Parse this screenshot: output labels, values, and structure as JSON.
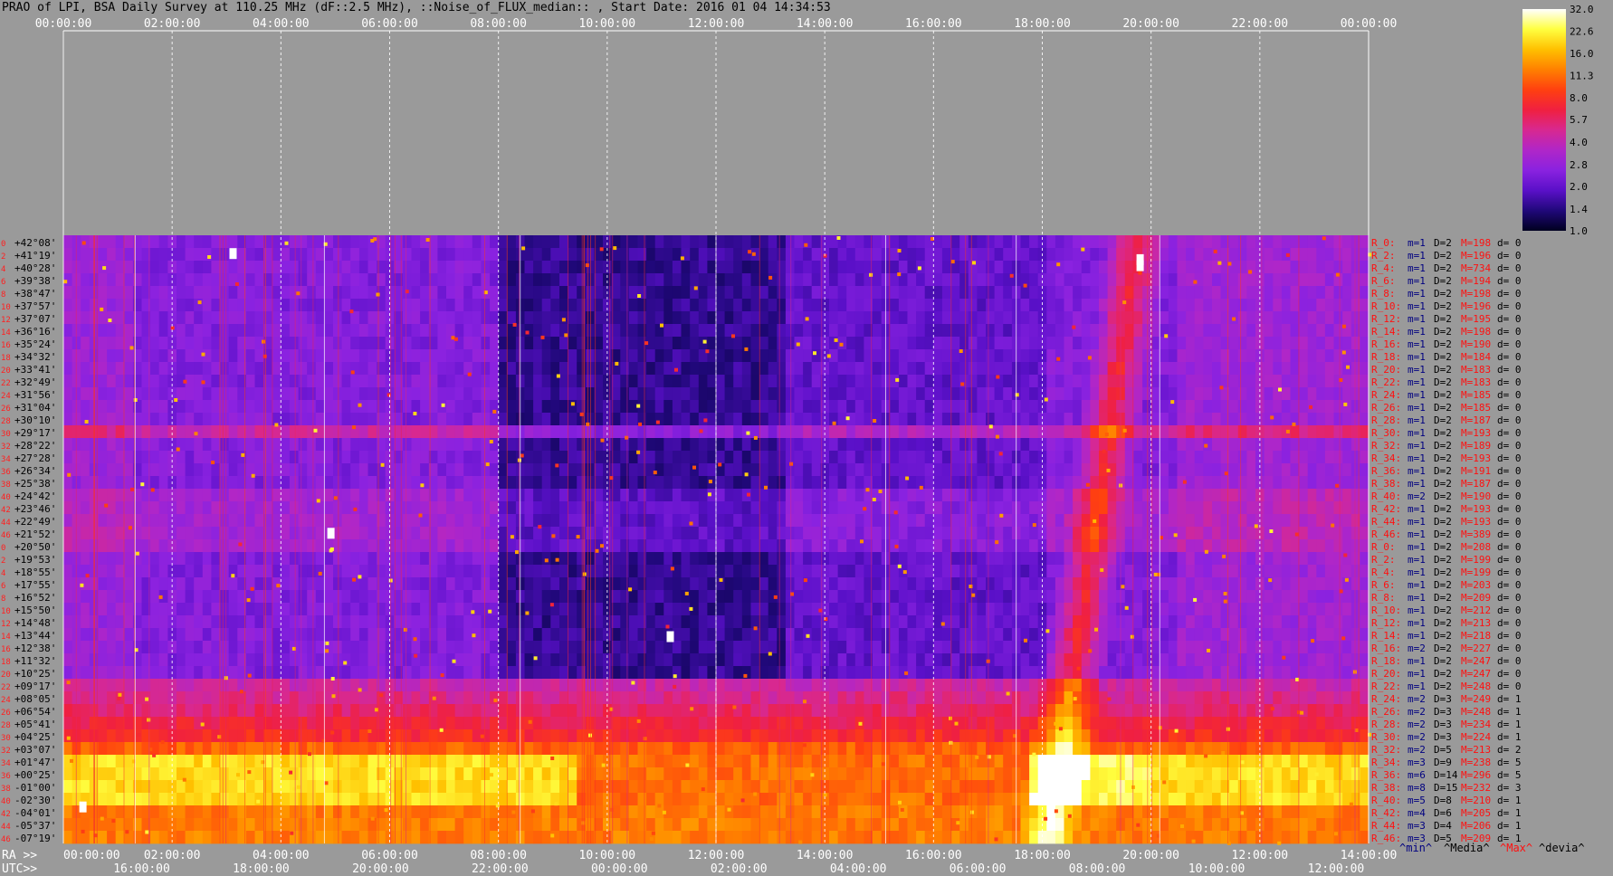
{
  "window": {
    "title": "PRAO of LPI, BSA Daily Survey at 110.25 MHz (dF::2.5 MHz), ::Noise_of_FLUX_median:: , Start Date: 2016 01 04 14:34:53"
  },
  "chart_data": {
    "type": "heatmap",
    "title": "PRAO of LPI, BSA Daily Survey at 110.25 MHz (dF::2.5 MHz), ::Noise_of_FLUX_median:: , Start Date: 2016 01 04 14:34:53",
    "top_axis_ticks": [
      "00:00:00",
      "02:00:00",
      "04:00:00",
      "06:00:00",
      "08:00:00",
      "10:00:00",
      "12:00:00",
      "14:00:00",
      "16:00:00",
      "18:00:00",
      "20:00:00",
      "22:00:00",
      "00:00:00"
    ],
    "ra_axis_label": "RA >>",
    "ra_ticks": [
      "00:00:00",
      "02:00:00",
      "04:00:00",
      "06:00:00",
      "08:00:00",
      "10:00:00",
      "12:00:00",
      "14:00:00",
      "16:00:00",
      "18:00:00",
      "20:00:00",
      "12:00:00",
      "14:00:00"
    ],
    "utc_axis_label": "UTC>>",
    "utc_ticks": [
      "16:00:00",
      "18:00:00",
      "20:00:00",
      "22:00:00",
      "00:00:00",
      "02:00:00",
      "04:00:00",
      "06:00:00",
      "08:00:00",
      "10:00:00",
      "12:00:00"
    ],
    "declinations": [
      "+42°08'",
      "+41°19'",
      "+40°28'",
      "+39°38'",
      "+38°47'",
      "+37°57'",
      "+37°07'",
      "+36°16'",
      "+35°24'",
      "+34°32'",
      "+33°41'",
      "+32°49'",
      "+31°56'",
      "+31°04'",
      "+30°10'",
      "+29°17'",
      "+28°22'",
      "+27°28'",
      "+26°34'",
      "+25°38'",
      "+24°42'",
      "+23°46'",
      "+22°49'",
      "+21°52'",
      "+20°50'",
      "+19°53'",
      "+18°55'",
      "+17°55'",
      "+16°52'",
      "+15°50'",
      "+14°48'",
      "+13°44'",
      "+12°38'",
      "+11°32'",
      "+10°25'",
      "+09°17'",
      "+08°05'",
      "+06°54'",
      "+05°41'",
      "+04°25'",
      "+03°07'",
      "+01°47'",
      "+00°25'",
      "-01°00'",
      "-02°30'",
      "-04°01'",
      "-05°37'",
      "-07°19'"
    ],
    "row_index_labels": [
      "0",
      "2",
      "4",
      "6",
      "8",
      "10",
      "12",
      "14",
      "16",
      "18",
      "20",
      "22",
      "24",
      "26",
      "28",
      "30",
      "32",
      "34",
      "36",
      "38",
      "40",
      "42",
      "44",
      "46",
      "0",
      "2",
      "4",
      "6",
      "8",
      "10",
      "12",
      "14",
      "16",
      "18",
      "20",
      "22",
      "24",
      "26",
      "28",
      "30",
      "32",
      "34",
      "36",
      "38",
      "40",
      "42",
      "44",
      "46"
    ],
    "beam_stats": [
      {
        "name": "R_0:",
        "m": "m=1",
        "D": "D=2",
        "M": "M=198",
        "d": "d= 0"
      },
      {
        "name": "R_2:",
        "m": "m=1",
        "D": "D=2",
        "M": "M=196",
        "d": "d= 0"
      },
      {
        "name": "R_4:",
        "m": "m=1",
        "D": "D=2",
        "M": "M=734",
        "d": "d= 0"
      },
      {
        "name": "R_6:",
        "m": "m=1",
        "D": "D=2",
        "M": "M=194",
        "d": "d= 0"
      },
      {
        "name": "R_8:",
        "m": "m=1",
        "D": "D=2",
        "M": "M=198",
        "d": "d= 0"
      },
      {
        "name": "R_10:",
        "m": "m=1",
        "D": "D=2",
        "M": "M=196",
        "d": "d= 0"
      },
      {
        "name": "R_12:",
        "m": "m=1",
        "D": "D=2",
        "M": "M=195",
        "d": "d= 0"
      },
      {
        "name": "R_14:",
        "m": "m=1",
        "D": "D=2",
        "M": "M=198",
        "d": "d= 0"
      },
      {
        "name": "R_16:",
        "m": "m=1",
        "D": "D=2",
        "M": "M=190",
        "d": "d= 0"
      },
      {
        "name": "R_18:",
        "m": "m=1",
        "D": "D=2",
        "M": "M=184",
        "d": "d= 0"
      },
      {
        "name": "R_20:",
        "m": "m=1",
        "D": "D=2",
        "M": "M=183",
        "d": "d= 0"
      },
      {
        "name": "R_22:",
        "m": "m=1",
        "D": "D=2",
        "M": "M=183",
        "d": "d= 0"
      },
      {
        "name": "R_24:",
        "m": "m=1",
        "D": "D=2",
        "M": "M=185",
        "d": "d= 0"
      },
      {
        "name": "R_26:",
        "m": "m=1",
        "D": "D=2",
        "M": "M=185",
        "d": "d= 0"
      },
      {
        "name": "R_28:",
        "m": "m=1",
        "D": "D=2",
        "M": "M=187",
        "d": "d= 0"
      },
      {
        "name": "R_30:",
        "m": "m=1",
        "D": "D=2",
        "M": "M=193",
        "d": "d= 0"
      },
      {
        "name": "R_32:",
        "m": "m=1",
        "D": "D=2",
        "M": "M=189",
        "d": "d= 0"
      },
      {
        "name": "R_34:",
        "m": "m=1",
        "D": "D=2",
        "M": "M=193",
        "d": "d= 0"
      },
      {
        "name": "R_36:",
        "m": "m=1",
        "D": "D=2",
        "M": "M=191",
        "d": "d= 0"
      },
      {
        "name": "R_38:",
        "m": "m=1",
        "D": "D=2",
        "M": "M=187",
        "d": "d= 0"
      },
      {
        "name": "R_40:",
        "m": "m=2",
        "D": "D=2",
        "M": "M=190",
        "d": "d= 0"
      },
      {
        "name": "R_42:",
        "m": "m=1",
        "D": "D=2",
        "M": "M=193",
        "d": "d= 0"
      },
      {
        "name": "R_44:",
        "m": "m=1",
        "D": "D=2",
        "M": "M=193",
        "d": "d= 0"
      },
      {
        "name": "R_46:",
        "m": "m=1",
        "D": "D=2",
        "M": "M=389",
        "d": "d= 0"
      },
      {
        "name": "R_0:",
        "m": "m=1",
        "D": "D=2",
        "M": "M=208",
        "d": "d= 0"
      },
      {
        "name": "R_2:",
        "m": "m=1",
        "D": "D=2",
        "M": "M=199",
        "d": "d= 0"
      },
      {
        "name": "R_4:",
        "m": "m=1",
        "D": "D=2",
        "M": "M=199",
        "d": "d= 0"
      },
      {
        "name": "R_6:",
        "m": "m=1",
        "D": "D=2",
        "M": "M=203",
        "d": "d= 0"
      },
      {
        "name": "R_8:",
        "m": "m=1",
        "D": "D=2",
        "M": "M=209",
        "d": "d= 0"
      },
      {
        "name": "R_10:",
        "m": "m=1",
        "D": "D=2",
        "M": "M=212",
        "d": "d= 0"
      },
      {
        "name": "R_12:",
        "m": "m=1",
        "D": "D=2",
        "M": "M=213",
        "d": "d= 0"
      },
      {
        "name": "R_14:",
        "m": "m=1",
        "D": "D=2",
        "M": "M=218",
        "d": "d= 0"
      },
      {
        "name": "R_16:",
        "m": "m=2",
        "D": "D=2",
        "M": "M=227",
        "d": "d= 0"
      },
      {
        "name": "R_18:",
        "m": "m=1",
        "D": "D=2",
        "M": "M=247",
        "d": "d= 0"
      },
      {
        "name": "R_20:",
        "m": "m=1",
        "D": "D=2",
        "M": "M=247",
        "d": "d= 0"
      },
      {
        "name": "R_22:",
        "m": "m=1",
        "D": "D=2",
        "M": "M=248",
        "d": "d= 0"
      },
      {
        "name": "R_24:",
        "m": "m=2",
        "D": "D=3",
        "M": "M=249",
        "d": "d= 1"
      },
      {
        "name": "R_26:",
        "m": "m=2",
        "D": "D=3",
        "M": "M=248",
        "d": "d= 1"
      },
      {
        "name": "R_28:",
        "m": "m=2",
        "D": "D=3",
        "M": "M=234",
        "d": "d= 1"
      },
      {
        "name": "R_30:",
        "m": "m=2",
        "D": "D=3",
        "M": "M=224",
        "d": "d= 1"
      },
      {
        "name": "R_32:",
        "m": "m=2",
        "D": "D=5",
        "M": "M=213",
        "d": "d= 2"
      },
      {
        "name": "R_34:",
        "m": "m=3",
        "D": "D=9",
        "M": "M=238",
        "d": "d= 5"
      },
      {
        "name": "R_36:",
        "m": "m=6",
        "D": "D=14",
        "M": "M=296",
        "d": "d= 5"
      },
      {
        "name": "R_38:",
        "m": "m=8",
        "D": "D=15",
        "M": "M=232",
        "d": "d= 3"
      },
      {
        "name": "R_40:",
        "m": "m=5",
        "D": "D=8",
        "M": "M=210",
        "d": "d= 1"
      },
      {
        "name": "R_42:",
        "m": "m=4",
        "D": "D=6",
        "M": "M=205",
        "d": "d= 1"
      },
      {
        "name": "R_44:",
        "m": "m=3",
        "D": "D=4",
        "M": "M=206",
        "d": "d= 1"
      },
      {
        "name": "R_46:",
        "m": "m=3",
        "D": "D=5",
        "M": "M=209",
        "d": "d= 1"
      }
    ],
    "stat_legend": [
      "^min^",
      "^Media^",
      "^Max^",
      "^devia^"
    ],
    "colorbar": {
      "ticks": [
        "32.0",
        "22.6",
        "16.0",
        "11.3",
        "8.0",
        "5.7",
        "4.0",
        "2.8",
        "2.0",
        "1.4",
        "1.0"
      ],
      "min": 1.0,
      "max": 32.0,
      "scale": "log2",
      "colormap": [
        "#000020",
        "#20087a",
        "#5a10c8",
        "#8a22e0",
        "#b026c8",
        "#d82890",
        "#f02040",
        "#ff4010",
        "#ff8000",
        "#ffc000",
        "#ffff40",
        "#ffffff"
      ]
    },
    "grid": "on",
    "background_color": "#9a9a9a"
  }
}
